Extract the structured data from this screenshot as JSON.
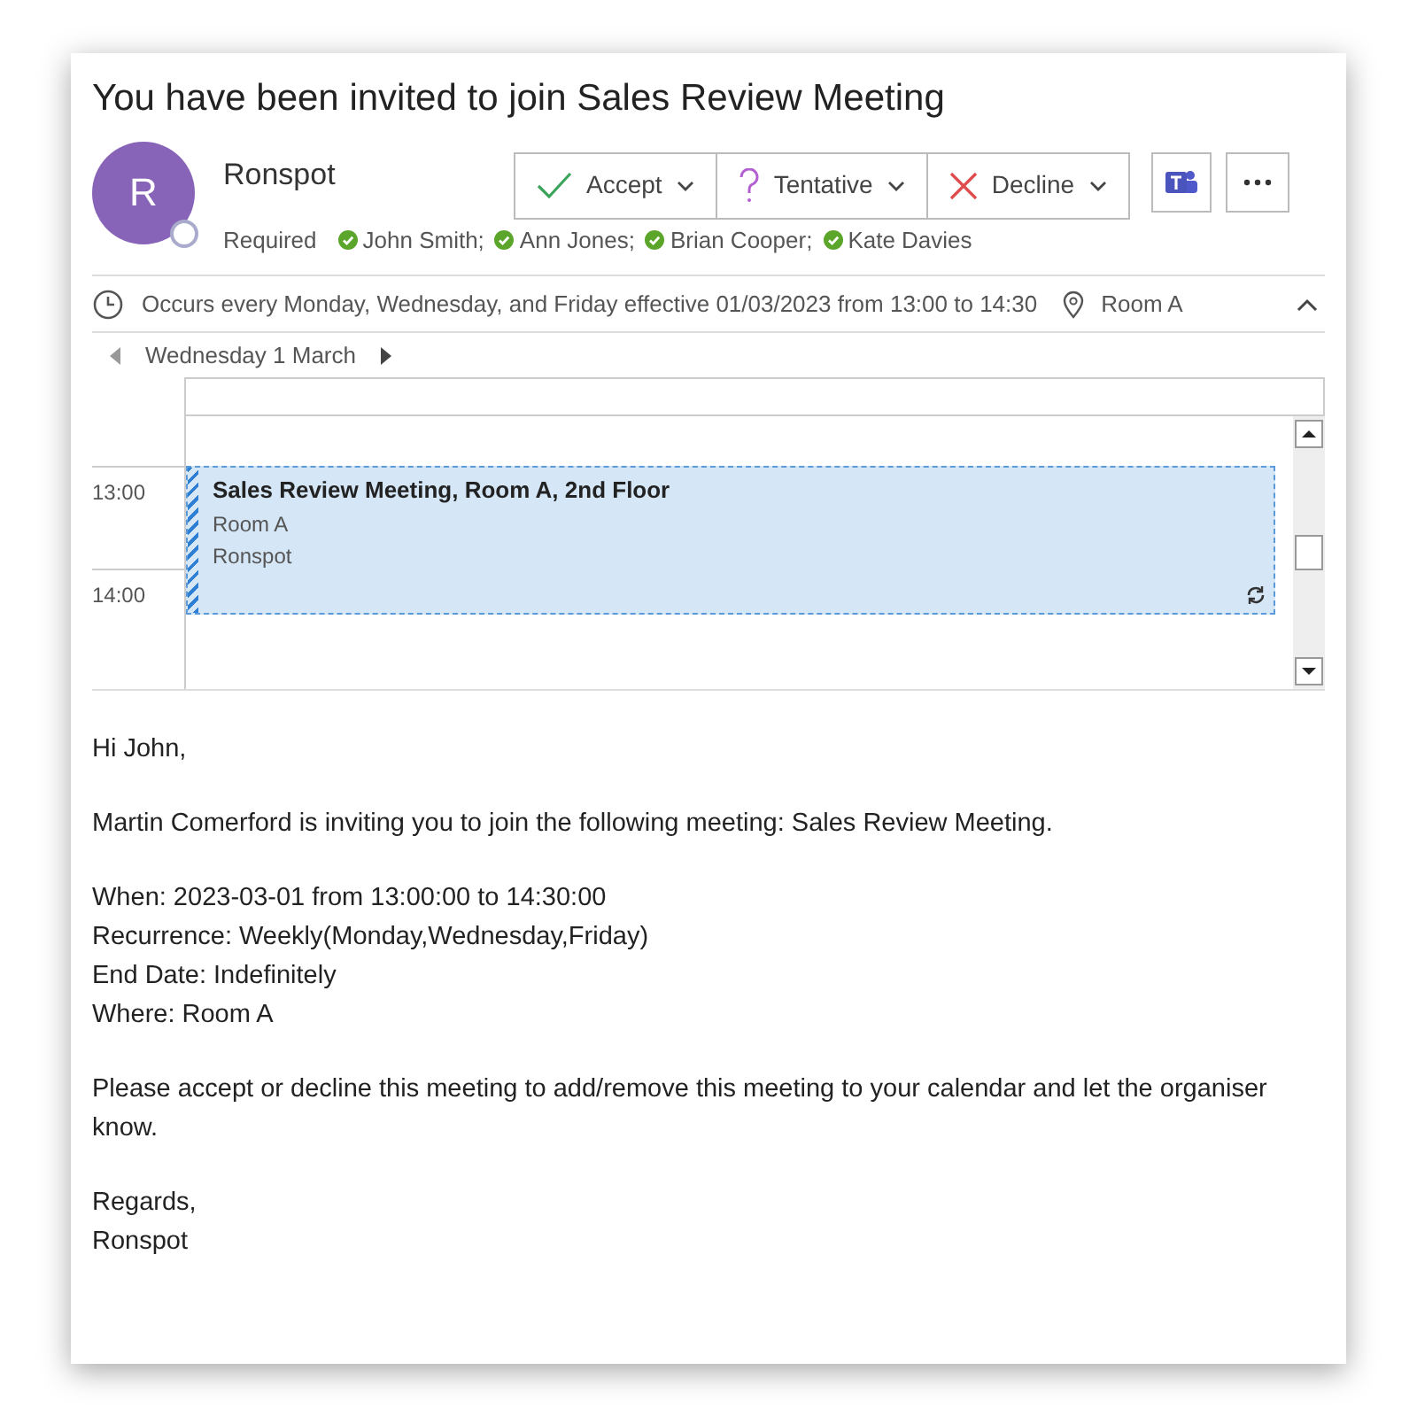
{
  "title": "You have been invited to join Sales Review Meeting",
  "sender": {
    "initial": "R",
    "name": "Ronspot"
  },
  "required_label": "Required",
  "attendees": [
    {
      "name": "John Smith;",
      "accepted": true
    },
    {
      "name": "Ann Jones;",
      "accepted": true
    },
    {
      "name": "Brian Cooper;",
      "accepted": true
    },
    {
      "name": "Kate Davies",
      "accepted": true
    }
  ],
  "actions": [
    {
      "kind": "accept",
      "label": "Accept"
    },
    {
      "kind": "tentative",
      "label": "Tentative"
    },
    {
      "kind": "decline",
      "label": "Decline"
    }
  ],
  "recurrence": "Occurs every Monday, Wednesday, and Friday effective 01/03/2023 from 13:00 to 14:30",
  "location": "Room A",
  "calendar": {
    "date": "Wednesday 1 March",
    "times": [
      "13:00",
      "14:00"
    ],
    "event": {
      "title": "Sales Review Meeting, Room A, 2nd Floor",
      "location": "Room A",
      "organizer": "Ronspot"
    }
  },
  "body": [
    [
      "Hi John,"
    ],
    [
      "Martin Comerford is inviting you to join the following meeting: Sales Review Meeting."
    ],
    [
      "When: 2023-03-01 from 13:00:00 to 14:30:00",
      "Recurrence: Weekly(Monday,Wednesday,Friday)",
      "End Date: Indefinitely",
      "Where: Room A"
    ],
    [
      "Please accept or decline this meeting to add/remove this meeting to your calendar and let the organiser know."
    ],
    [
      "Regards,",
      "Ronspot"
    ]
  ]
}
